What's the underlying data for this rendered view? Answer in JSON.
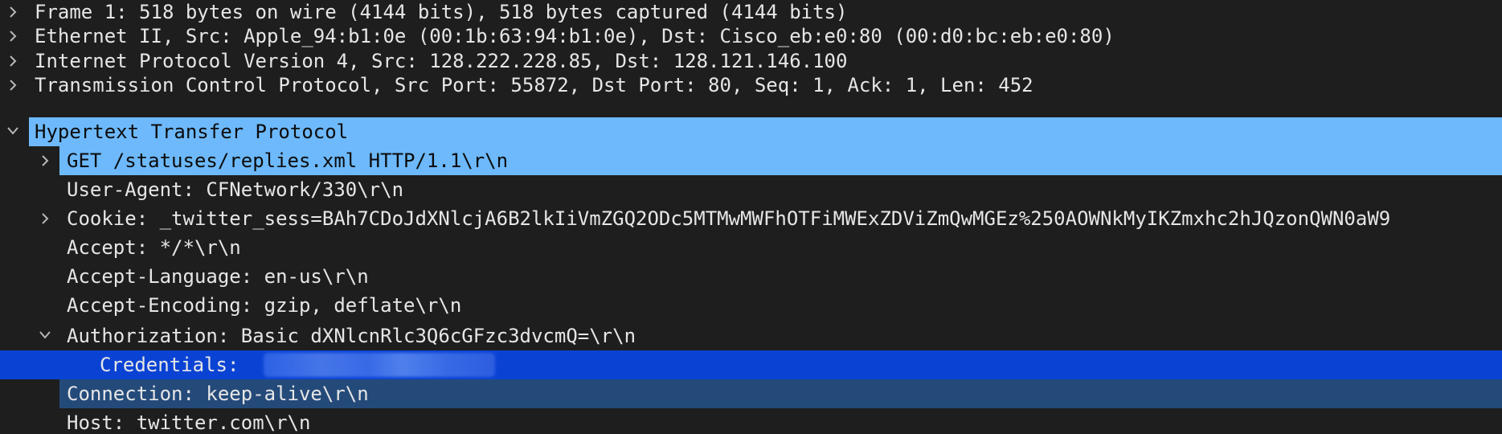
{
  "rows": [
    {
      "text": "Frame 1: 518 bytes on wire (4144 bits), 518 bytes captured (4144 bits)",
      "twisty": "collapsed"
    },
    {
      "text": "Ethernet II, Src: Apple_94:b1:0e (00:1b:63:94:b1:0e), Dst: Cisco_eb:e0:80 (00:d0:bc:eb:e0:80)",
      "twisty": "collapsed"
    },
    {
      "text": "Internet Protocol Version 4, Src: 128.222.228.85, Dst: 128.121.146.100",
      "twisty": "collapsed"
    },
    {
      "text": "Transmission Control Protocol, Src Port: 55872, Dst Port: 80, Seq: 1, Ack: 1, Len: 452",
      "twisty": "collapsed"
    },
    {
      "text": "Hypertext Transfer Protocol",
      "twisty": "expanded"
    },
    {
      "text": "GET /statuses/replies.xml HTTP/1.1\\r\\n",
      "twisty": "collapsed"
    },
    {
      "text": "User-Agent: CFNetwork/330\\r\\n",
      "twisty": "none"
    },
    {
      "text": "Cookie: _twitter_sess=BAh7CDoJdXNlcjA6B2lkIiVmZGQ2ODc5MTMwMWFhOTFiMWExZDViZmQwMGEz%250AOWNkMyIKZmxhc2hJQzonQWN0aW9",
      "twisty": "collapsed"
    },
    {
      "text": "Accept: */*\\r\\n",
      "twisty": "none"
    },
    {
      "text": "Accept-Language: en-us\\r\\n",
      "twisty": "none"
    },
    {
      "text": "Accept-Encoding: gzip, deflate\\r\\n",
      "twisty": "none"
    },
    {
      "text": "Authorization: Basic dXNlcnRlc3Q6cGFzc3dvcmQ=\\r\\n",
      "twisty": "expanded"
    },
    {
      "text": "Credentials:",
      "twisty": "none"
    },
    {
      "text": "Connection: keep-alive\\r\\n",
      "twisty": "none"
    },
    {
      "text": "Host: twitter.com\\r\\n",
      "twisty": "none"
    }
  ],
  "colors": {
    "background": "#1e1e1e",
    "text": "#e6e6e6",
    "selected_light": "#6db9fb",
    "selected_active": "#0a43d4",
    "selected_related": "#244a7a"
  },
  "icons": {
    "collapsed": "chevron-right-icon",
    "expanded": "chevron-down-icon"
  }
}
